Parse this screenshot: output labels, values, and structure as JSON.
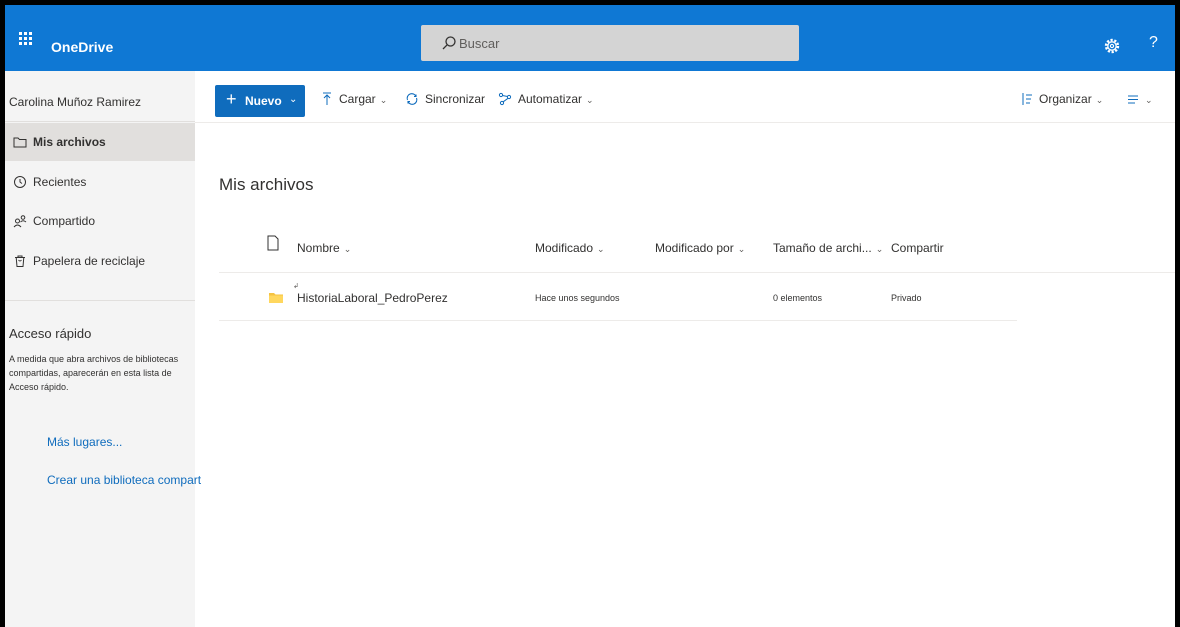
{
  "app": {
    "brand": "OneDrive"
  },
  "search": {
    "placeholder": "Buscar"
  },
  "header_icons": {
    "help": "?"
  },
  "sidebar": {
    "user_name": "Carolina Muñoz Ramirez",
    "items": [
      {
        "label": "Mis archivos",
        "icon": "folder-icon",
        "selected": true
      },
      {
        "label": "Recientes",
        "icon": "clock-icon",
        "selected": false
      },
      {
        "label": "Compartido",
        "icon": "people-icon",
        "selected": false
      },
      {
        "label": "Papelera de reciclaje",
        "icon": "trash-icon",
        "selected": false
      }
    ],
    "quick_access": {
      "title": "Acceso rápido",
      "description": "A medida que abra archivos de bibliotecas compartidas, aparecerán en esta lista de Acceso rápido.",
      "more_places": "Más lugares...",
      "create_library": "Crear una biblioteca compart"
    }
  },
  "toolbar": {
    "new_label": "Nuevo",
    "upload_label": "Cargar",
    "sync_label": "Sincronizar",
    "automate_label": "Automatizar",
    "organize_label": "Organizar"
  },
  "main": {
    "title": "Mis archivos",
    "columns": {
      "name": "Nombre",
      "modified": "Modificado",
      "modified_by": "Modificado por",
      "size": "Tamaño de archi...",
      "sharing": "Compartir"
    },
    "rows": [
      {
        "name": "HistoriaLaboral_PedroPerez",
        "modified": "Hace unos segundos",
        "modified_by": "",
        "size": "0 elementos",
        "sharing": "Privado"
      }
    ]
  },
  "colors": {
    "suitebar": "#0f78d4",
    "primary_button": "#0f6cbd",
    "link": "#0f6cbd",
    "folder": "#f5c342",
    "nav_background": "#f4f4f4"
  }
}
